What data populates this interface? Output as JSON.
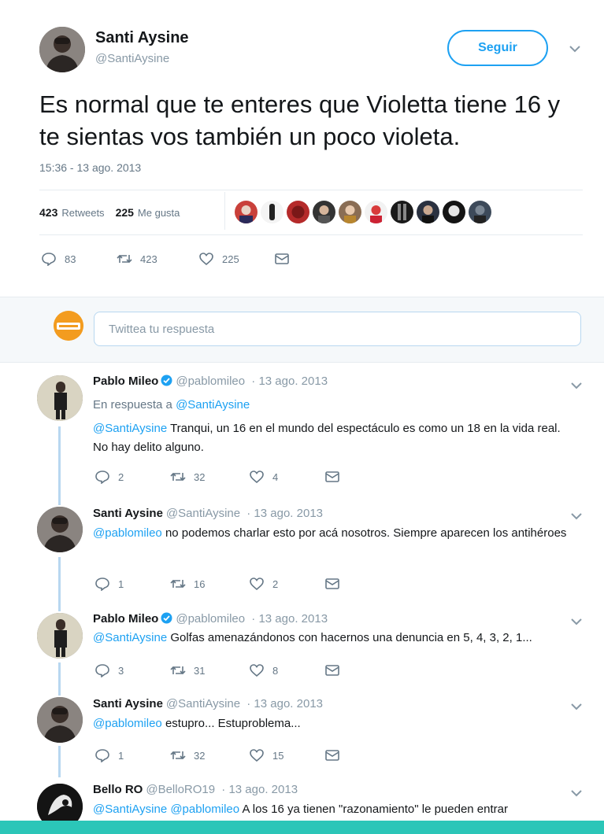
{
  "main_tweet": {
    "author_name": "Santi Aysine",
    "author_handle": "@SantiAysine",
    "follow_label": "Seguir",
    "text": "Es normal que te enteres que Violetta tiene 16 y te sientas vos también un poco violeta.",
    "timestamp": "15:36 - 13 ago. 2013",
    "retweets_count": "423",
    "retweets_label": "Retweets",
    "likes_count": "225",
    "likes_label": "Me gusta",
    "actions": {
      "replies": "83",
      "retweets": "423",
      "likes": "225"
    }
  },
  "reply_box": {
    "placeholder": "Twittea tu respuesta"
  },
  "replies": [
    {
      "name": "Pablo Mileo",
      "verified": true,
      "handle": "@pablomileo",
      "date": "· 13 ago. 2013",
      "in_reply_prefix": "En respuesta a",
      "in_reply_to": "@SantiAysine",
      "mention": "@SantiAysine",
      "text": "Tranqui, un 16 en el mundo del espectáculo es como un 18 en la vida real. No hay delito alguno.",
      "counts": {
        "replies": "2",
        "retweets": "32",
        "likes": "4"
      }
    },
    {
      "name": "Santi Aysine",
      "verified": false,
      "handle": "@SantiAysine",
      "date": "· 13 ago. 2013",
      "mention": "@pablomileo",
      "text": "no podemos charlar esto por acá nosotros. Siempre aparecen los antihéroes",
      "counts": {
        "replies": "1",
        "retweets": "16",
        "likes": "2"
      }
    },
    {
      "name": "Pablo Mileo",
      "verified": true,
      "handle": "@pablomileo",
      "date": "· 13 ago. 2013",
      "mention": "@SantiAysine",
      "text": "Golfas amenazándonos con hacernos una denuncia en 5, 4, 3, 2, 1...",
      "counts": {
        "replies": "3",
        "retweets": "31",
        "likes": "8"
      }
    },
    {
      "name": "Santi Aysine",
      "verified": false,
      "handle": "@SantiAysine",
      "date": "· 13 ago. 2013",
      "mention": "@pablomileo",
      "text": "estupro... Estuproblema...",
      "counts": {
        "replies": "1",
        "retweets": "32",
        "likes": "15"
      }
    },
    {
      "name": "Bello RO",
      "verified": false,
      "handle": "@BelloRO19",
      "date": "· 13 ago. 2013",
      "mention": "@SantiAysine @pablomileo",
      "text": "A los 16 ya tienen \"razonamiento\" le pueden entrar"
    }
  ],
  "colors": {
    "accent": "#1da1f2",
    "muted": "#657786",
    "thread": "#b8d7f0",
    "bottom_bar": "#2bc6b8"
  }
}
